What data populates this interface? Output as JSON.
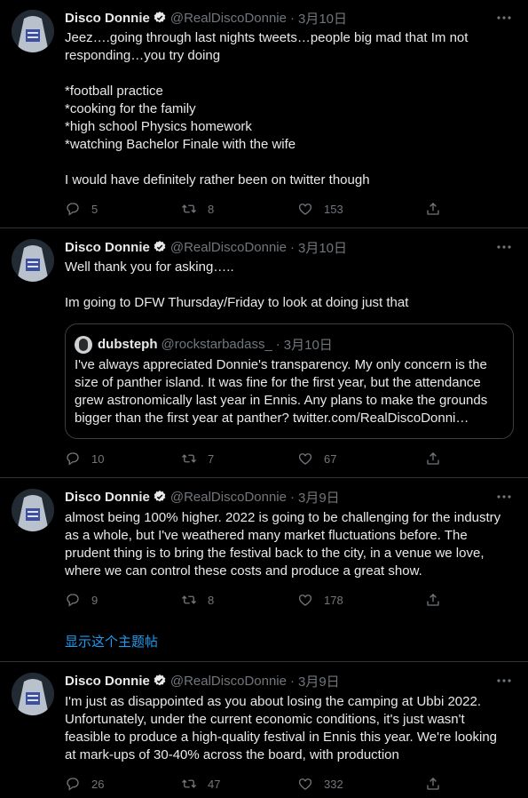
{
  "colors": {
    "background": "#000000",
    "text": "#e7e9ea",
    "muted": "#71767b",
    "accent": "#1d9bf0",
    "divider": "#2f3336"
  },
  "tweets": [
    {
      "name": "Disco Donnie",
      "handle": "@RealDiscoDonnie",
      "dot": "·",
      "date": "3月10日",
      "text": "Jeez….going through last nights tweets…people big mad that Im not\nresponding…you try doing\n\n*football practice\n*cooking for the family\n*high school Physics homework\n*watching Bachelor Finale with the wife\n\nI would have definitely rather been on twitter though",
      "replies": "5",
      "retweets": "8",
      "likes": "153"
    },
    {
      "name": "Disco Donnie",
      "handle": "@RealDiscoDonnie",
      "dot": "·",
      "date": "3月10日",
      "text": "Well thank you for asking…..\n\nIm going to DFW Thursday/Friday to look at doing just that",
      "quote": {
        "name": "dubsteph",
        "handle": "@rockstarbadass_",
        "dot": "·",
        "date": "3月10日",
        "text": "I've always appreciated Donnie's transparency. My only concern is the size of panther island. It was fine for the first year, but the attendance grew astronomically last year in Ennis. Any plans to make the grounds bigger than the first year at panther? twitter.com/RealDiscoDonni…"
      },
      "replies": "10",
      "retweets": "7",
      "likes": "67"
    },
    {
      "name": "Disco Donnie",
      "handle": "@RealDiscoDonnie",
      "dot": "·",
      "date": "3月9日",
      "text": "almost being 100% higher. 2022 is going to be challenging for the industry as a whole, but I've weathered many market fluctuations before. The prudent thing is to bring the festival back to the city, in a venue we love, where we can control these costs and produce a great show.",
      "replies": "9",
      "retweets": "8",
      "likes": "178"
    },
    {
      "name": "Disco Donnie",
      "handle": "@RealDiscoDonnie",
      "dot": "·",
      "date": "3月9日",
      "text": "I'm just as disappointed as you about losing the camping at Ubbi 2022. Unfortunately, under the current economic conditions, it's just wasn't feasible to produce a high-quality festival in Ennis this year.  We're looking at mark-ups of 30-40% across the board, with production",
      "replies": "26",
      "retweets": "47",
      "likes": "332"
    }
  ],
  "show_thread_label": "显示这个主题帖",
  "icons": [
    "verified-badge-icon",
    "more-icon",
    "reply-icon",
    "retweet-icon",
    "like-icon",
    "share-icon"
  ]
}
